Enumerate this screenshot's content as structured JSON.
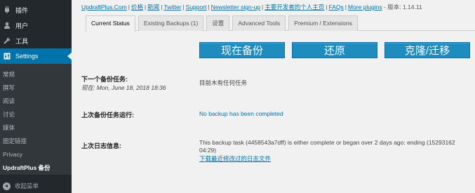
{
  "sidebar": {
    "items": [
      {
        "label": "插件",
        "icon": "plugin-icon"
      },
      {
        "label": "用户",
        "icon": "user-icon"
      },
      {
        "label": "工具",
        "icon": "wrench-icon"
      },
      {
        "label": "Settings",
        "icon": "settings-icon"
      }
    ],
    "submenu": [
      "常规",
      "撰写",
      "阅读",
      "讨论",
      "媒体",
      "固定链接",
      "Privacy",
      "UpdraftPlus 备份"
    ],
    "collapse_label": "收起菜单"
  },
  "toplinks": {
    "items": [
      "UpdraftPlus.Com",
      "价格",
      "新闻",
      "Twitter",
      "Support",
      "Newsletter sign-up",
      "主要开发者的个人主页",
      "FAQs",
      "More plugins"
    ],
    "version": "- 版本: 1.14.11"
  },
  "tabs": [
    "Current Status",
    "Existing Backups (1)",
    "设置",
    "Advanced Tools",
    "Premium / Extensions"
  ],
  "actions": {
    "backup_now": "现在备份",
    "restore": "还原",
    "clone": "克隆/迁移"
  },
  "next_backup": {
    "label": "下一个备份任务:",
    "now_label": "现在",
    "now_value": ": Mon, June 18, 2018 18:36",
    "value": "目前木有任何任务"
  },
  "last_run": {
    "label": "上次备份任务运行:",
    "value": "No backup has been completed"
  },
  "last_log": {
    "label": "上次日志信息:",
    "line1": "This backup task (4458543a7dff) is either complete or began over 2 days ago: ending (15293162",
    "line2": "04:29)",
    "link": "下载最近修改过的日志文件"
  }
}
